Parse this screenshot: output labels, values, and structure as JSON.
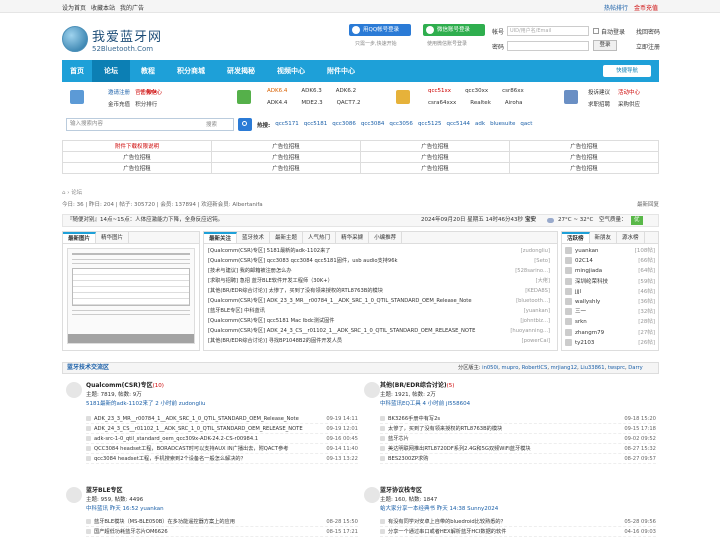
{
  "topbar": {
    "left": [
      "设为首页",
      "收藏本站",
      "我的广告"
    ],
    "hot": "热帖排行",
    "gold": "金币充值"
  },
  "logo": {
    "cn": "我爱蓝牙网",
    "en": "52Bluetooth.Com"
  },
  "social": {
    "qq": "用QQ帐号登录",
    "qq_sub": "只需一步,快速开始",
    "wx": "微信账号登录",
    "wx_sub": "使用微信账号登录"
  },
  "login": {
    "account_label": "帐号",
    "account_placeholder": "UID/用户名/Email",
    "password_label": "密码",
    "auto": "自动登录",
    "forgot": "找回密码",
    "login_btn": "登录",
    "register_btn": "立即注册"
  },
  "nav": {
    "items": [
      "首页",
      "论坛",
      "教程",
      "积分商城",
      "研发揭秘",
      "视频中心",
      "附件中心"
    ],
    "quick": "快捷导航"
  },
  "cat1": {
    "a": "邀请注册",
    "b": "任务中心",
    "c": "官方微信",
    "d": "金币充值",
    "e": "积分排行"
  },
  "cat2": {
    "row1": [
      "ADK6.4",
      "ADK6.3",
      "ADK6.2"
    ],
    "row2": [
      "ADK4.4",
      "MDE2.3",
      "QACT7.2"
    ]
  },
  "cat3": {
    "row1": [
      "qcc51xx",
      "qcc30xx",
      "csr86xx"
    ],
    "row2": [
      "csra64xxx",
      "Realtek",
      "Airoha"
    ]
  },
  "cat4": {
    "row1": [
      "投诉建议",
      "活动中心"
    ],
    "row2": [
      "求职招聘",
      "采购供应"
    ]
  },
  "search": {
    "placeholder": "输入搜索内容",
    "type": "搜索"
  },
  "hot": {
    "label": "热搜:",
    "items": [
      "qcc5171",
      "qcc5181",
      "qcc3086",
      "qcc3084",
      "qcc3056",
      "qcc5125",
      "qcc5144",
      "adk",
      "bluesuite",
      "qact"
    ]
  },
  "ads": [
    [
      "附件下载权限说明",
      "广告位招租",
      "广告位招租",
      "广告位招租"
    ],
    [
      "广告位招租",
      "广告位招租",
      "广告位招租",
      "广告位招租"
    ],
    [
      "广告位招租",
      "广告位招租",
      "广告位招租",
      "广告位招租"
    ]
  ],
  "breadcrumb": "› 论坛",
  "stats": {
    "text": "今日: 36 | 昨日: 204 | 帖子: 305720 | 会员: 137894 | 欢迎新会员: Albertanifa",
    "latest": "最新回复"
  },
  "weather": {
    "text": "『随便对别』14点~15点：人体应激能力下降，全身反应迟钝。",
    "date": "2024年09月20日 星期五 14时46分43秒",
    "city": "宝安",
    "temp": "27°C ~ 32°C",
    "air": "空气质量：",
    "quality": "优"
  },
  "left_tabs": [
    "最新图片",
    "精华图片"
  ],
  "mid_tabs": [
    "最新关注",
    "蓝牙技术",
    "最新主题",
    "人气热门",
    "精华采撷",
    "小编推荐"
  ],
  "news": [
    {
      "t": "[Qualcomm(CSR)专区] 5181最新的adk-1102来了",
      "s": "[zudongliu]"
    },
    {
      "t": "[Qualcomm(CSR)专区] qcc3083 qcc3084 qcc5181固件，usb audio支持96k",
      "s": "[Seto]"
    },
    {
      "t": "[技术与建议] 我的邮箱被注册怎么办",
      "s": "[528sarino...]"
    },
    {
      "t": "[求职与招聘] 急招 蓝牙BLE软件开发工程师（30K+）",
      "s": "[大佬]"
    },
    {
      "t": "[其他(BR/EDR综合讨论)] 太惨了，买到了没有领来授权的RTL8763B的模块",
      "s": "[KEDA8S]"
    },
    {
      "t": "[Qualcomm(CSR)专区] ADK_23_3_MR__r00784_1__ADK_SRC_1_0_QTIL_STANDARD_OEM_Release_Note",
      "s": "[bluetooth...]"
    },
    {
      "t": "[蓝牙BLE专区] 中科蓝讯",
      "s": "[yuankan]"
    },
    {
      "t": "[Qualcomm(CSR)专区] qcc5181 Mac Ibdc测试固件",
      "s": "[johntbiz...]"
    },
    {
      "t": "[Qualcomm(CSR)专区] ADK_24_3_CS__r01102_1__ADK_SRC_1_0_QTIL_STANDARD_OEM_RELEASE_NOTE",
      "s": "[huoyanning...]"
    },
    {
      "t": "[其他(BR/EDR综合讨论)] 寻找BP1048B2的固件开发人员",
      "s": "[powerCai]"
    }
  ],
  "rank_tabs": [
    "活跃榜",
    "新朋友",
    "源水榜"
  ],
  "rank": [
    {
      "n": "yuankan",
      "v": "[108帖]"
    },
    {
      "n": "02C14",
      "v": "[66帖]"
    },
    {
      "n": "mingjiada",
      "v": "[64帖]"
    },
    {
      "n": "深圳纶荣科技",
      "v": "[59帖]"
    },
    {
      "n": "jjjl",
      "v": "[46帖]"
    },
    {
      "n": "wallyshly",
      "v": "[36帖]"
    },
    {
      "n": "三一",
      "v": "[32帖]"
    },
    {
      "n": "srkn",
      "v": "[28帖]"
    },
    {
      "n": "zhangm79",
      "v": "[27帖]"
    },
    {
      "n": "ty2103",
      "v": "[26帖]"
    }
  ],
  "section": {
    "title": "蓝牙技术交流区",
    "mods_label": "分区版主:",
    "mods": [
      "in050i",
      "mupro",
      "RobertICS",
      "mrjiang12",
      "Liu33861",
      "twsprc",
      "Darry"
    ]
  },
  "forums": [
    {
      "name": "Qualcomm(CSR)专区",
      "count": "(10)",
      "meta": "主题: 7819, 帖数: 9万",
      "last": "5181最新的adk-1102来了 2 小时前 zudongliu",
      "threads": [
        {
          "t": "ADK_23_3_MR__r00784_1__ADK_SRC_1_0_QTIL_STANDARD_OEM_Release_Note",
          "d": "09-19 14:11"
        },
        {
          "t": "ADK_24_3_CS__r01102_1__ADK_SRC_1_0_QTIL_STANDARD_OEM_RELEASE_NOTE",
          "d": "09-19 12:01"
        },
        {
          "t": "adk-src-1-0_qtil_standard_oem_qcc309x-ADK-24.2-CS-r00984.1",
          "d": "09-16 00:45"
        },
        {
          "t": "QCC3084 headset工程，BORADCAST时可以支持AUX IN广播出去，附QACT参考",
          "d": "09-14 11:40"
        },
        {
          "t": "qcc3084 headset工程，手机搜索到2个设备名一般怎么解决的？",
          "d": "09-13 13:22"
        }
      ]
    },
    {
      "name": "其他(BR/EDR综合讨论)",
      "count": "(5)",
      "meta": "主题: 1921, 帖数: 2万",
      "last": "中科蓝讯EQ工具 4 小时前 jl558604",
      "threads": [
        {
          "t": "BK3266手册中有写2s",
          "d": "09-18 15:20"
        },
        {
          "t": "太惨了，买到了没有领来授权的RTL8763B的模块",
          "d": "09-15 17:18"
        },
        {
          "t": "蓝牙芯片",
          "d": "09-02 09:52"
        },
        {
          "t": "美达明联网推出RTL8720DF系列2.4G和5G双频WiFi蓝牙模块",
          "d": "08-27 15:32"
        },
        {
          "t": "BES2300ZP求购",
          "d": "08-27 09:57"
        }
      ]
    },
    {
      "name": "蓝牙BLE专区",
      "count": "",
      "meta": "主题: 959, 帖数: 4496",
      "last": "中科蓝讯 昨天 16:52 yuankan",
      "threads": [
        {
          "t": "蓝牙BLE模块（MS-BLE050B）在多功能遥控器方案上的应用",
          "d": "08-28 15:50"
        },
        {
          "t": "国产超低功耗蓝牙芯片OM6626",
          "d": "08-15 17:21"
        }
      ]
    },
    {
      "name": "蓝牙协议栈专区",
      "count": "",
      "meta": "主题: 160, 帖数: 1847",
      "last": "蛤大家分享一本经典书 昨天 14:38 Sunny2024",
      "threads": [
        {
          "t": "有没有同学对安卓上自带的bluedroid比较熟悉的？",
          "d": "05-28 09:56"
        },
        {
          "t": "分享一个通过串口或者HEX解析蓝牙HCI数据的软件",
          "d": "04-16 09:03"
        }
      ]
    }
  ]
}
